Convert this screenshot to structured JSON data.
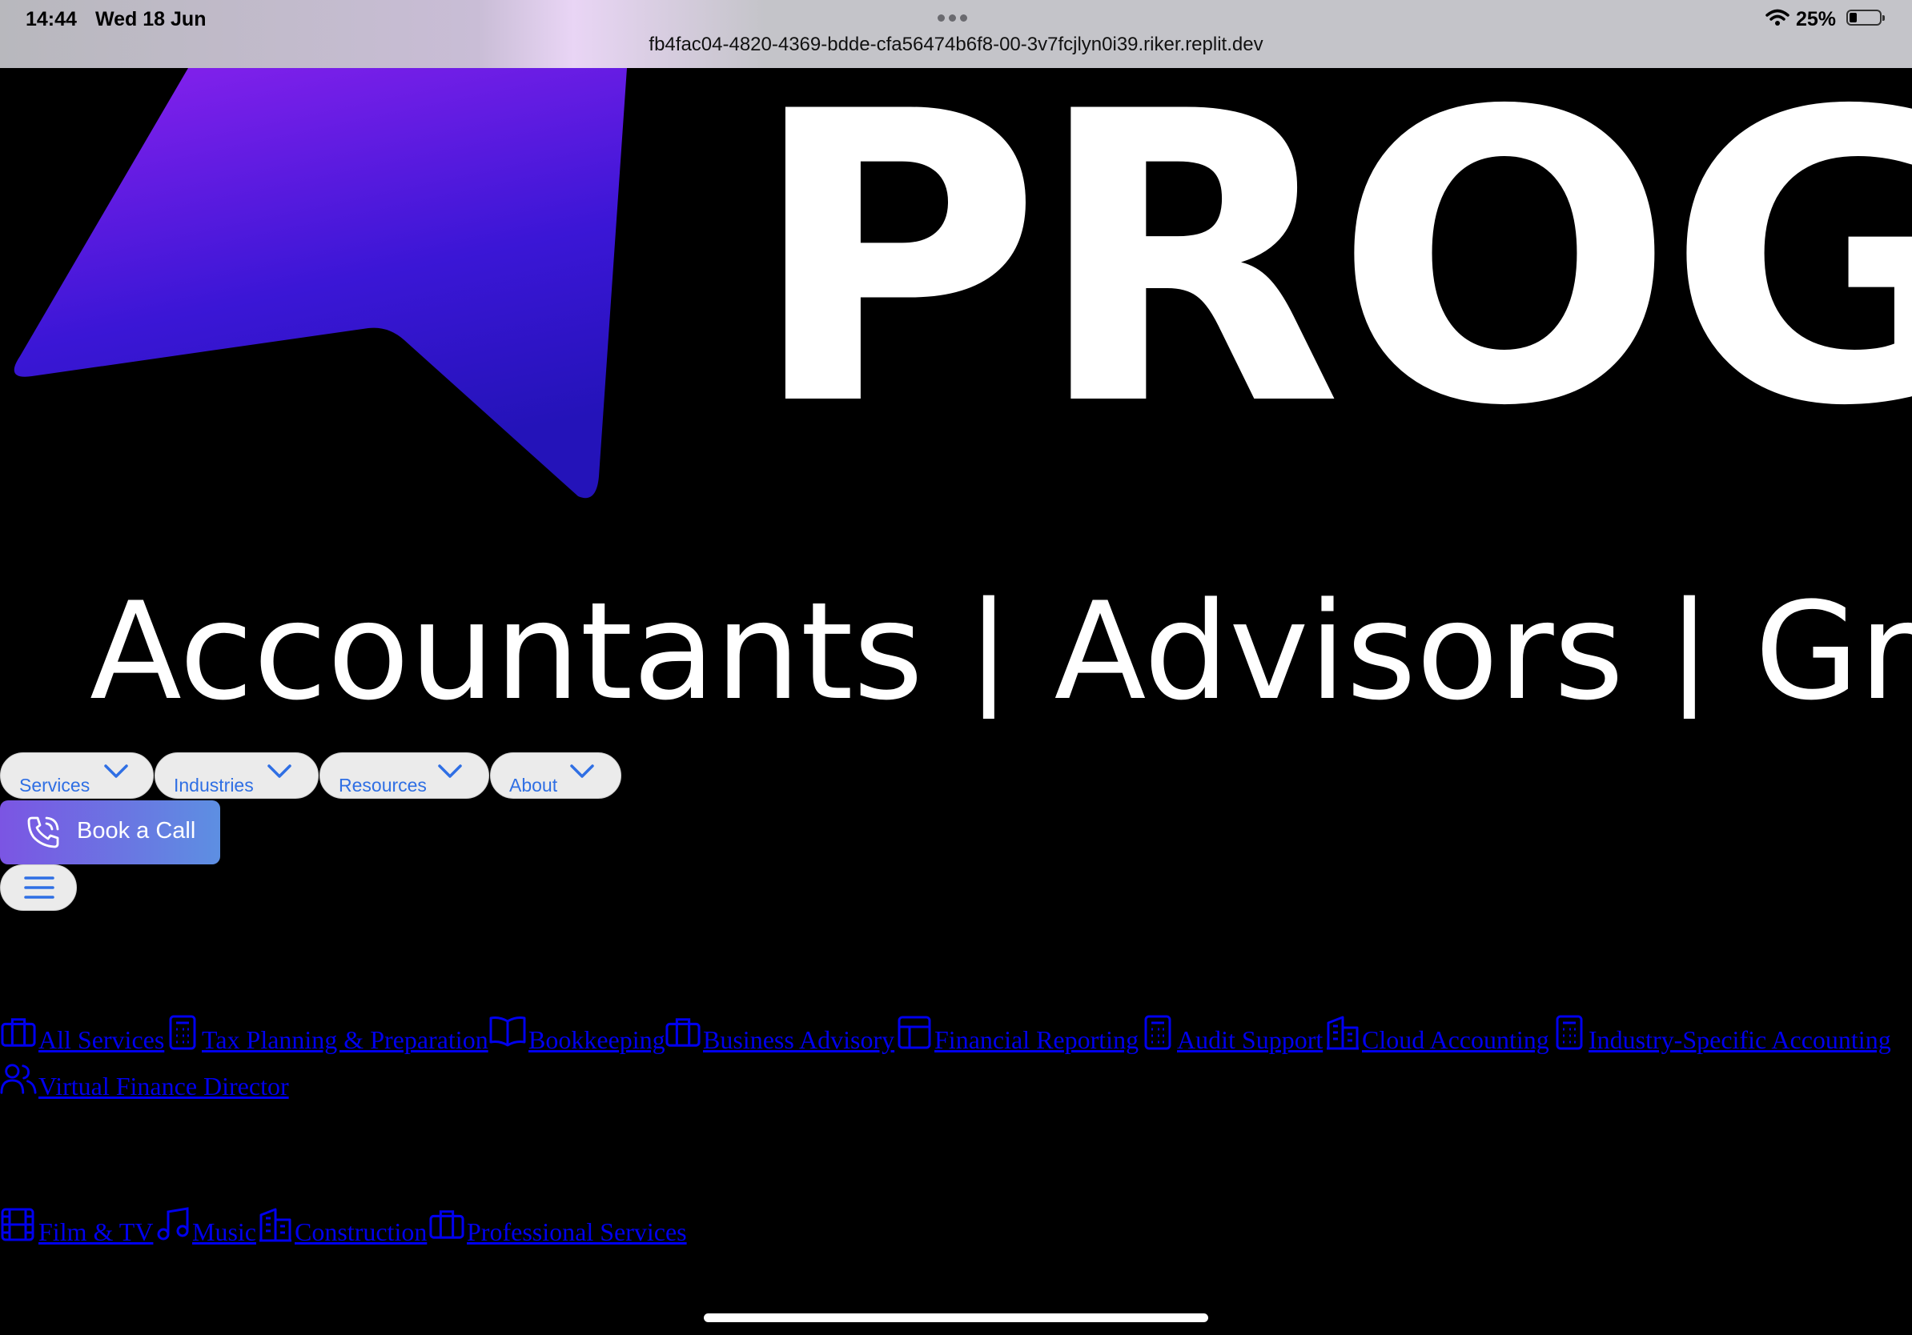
{
  "status_bar": {
    "time": "14:44",
    "date": "Wed 18 Jun",
    "url": "fb4fac04-4820-4369-bdde-cfa56474b6f8-00-3v7fcjlyn0i39.riker.replit.dev",
    "battery": "25%"
  },
  "hero": {
    "logo_text": "PROG",
    "tagline": "Accountants | Advisors | Gr"
  },
  "nav": {
    "items": [
      {
        "label": "Services"
      },
      {
        "label": "Industries"
      },
      {
        "label": "Resources"
      },
      {
        "label": "About"
      }
    ],
    "book_label": "Book a Call"
  },
  "services_links": [
    {
      "label": "All Services",
      "icon": "briefcase-icon"
    },
    {
      "label": "Tax Planning & Preparation",
      "icon": "calculator-icon"
    },
    {
      "label": "Bookkeeping",
      "icon": "book-open-icon"
    },
    {
      "label": "Business Advisory",
      "icon": "briefcase-icon"
    },
    {
      "label": "Financial Reporting",
      "icon": "layout-icon"
    },
    {
      "label": "Audit Support",
      "icon": "calculator-icon"
    },
    {
      "label": "Cloud Accounting",
      "icon": "buildings-icon"
    },
    {
      "label": "Industry-Specific Accounting",
      "icon": "calculator-icon"
    },
    {
      "label": "Virtual Finance Director",
      "icon": "users-icon"
    }
  ],
  "industry_links": [
    {
      "label": "Film & TV",
      "icon": "film-icon"
    },
    {
      "label": "Music",
      "icon": "music-icon"
    },
    {
      "label": "Construction",
      "icon": "buildings-icon"
    },
    {
      "label": "Professional Services",
      "icon": "briefcase-icon"
    }
  ],
  "colors": {
    "link": "#0000ee",
    "nav_text": "#2f6fe4",
    "button_gradient_start": "#7b55e3",
    "button_gradient_end": "#5d8fe2"
  }
}
